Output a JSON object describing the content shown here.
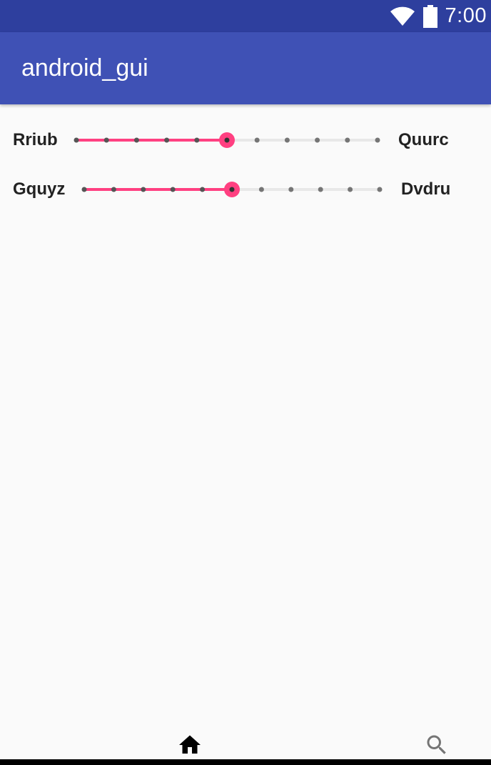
{
  "status_bar": {
    "time": "7:00",
    "icons": [
      "wifi-icon",
      "battery-icon"
    ],
    "background": "#2E3F9E"
  },
  "app_bar": {
    "title": "android_gui",
    "background": "#3F51B5"
  },
  "sliders": [
    {
      "left_label": "Rriub",
      "right_label": "Quurc",
      "value": 5,
      "max": 10,
      "accent": "#FF4081"
    },
    {
      "left_label": "Gquyz",
      "right_label": "Dvdru",
      "value": 5,
      "max": 10,
      "accent": "#FF4081"
    }
  ],
  "bottom_nav": {
    "items": [
      {
        "icon": "home-icon"
      },
      {
        "icon": "search-icon"
      }
    ]
  }
}
